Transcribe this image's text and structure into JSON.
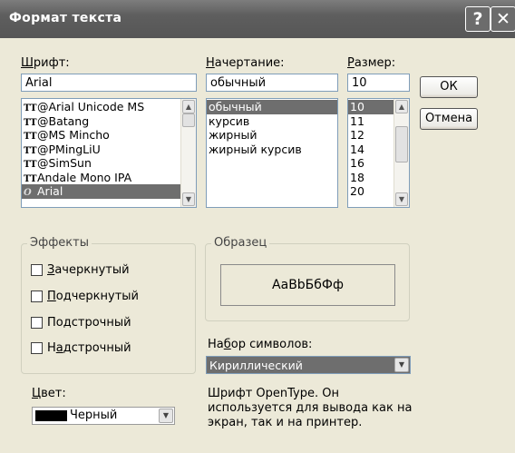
{
  "dialog": {
    "title": "Формат текста",
    "help_glyph": "?",
    "close_glyph": "✕"
  },
  "font": {
    "label_prefix": "",
    "label_u": "Ш",
    "label_rest": "рифт:",
    "value": "Arial",
    "items": [
      {
        "label": "@Arial Unicode MS",
        "icon": "TT"
      },
      {
        "label": "@Batang",
        "icon": "TT"
      },
      {
        "label": "@MS Mincho",
        "icon": "TT"
      },
      {
        "label": "@PMingLiU",
        "icon": "TT"
      },
      {
        "label": "@SimSun",
        "icon": "TT"
      },
      {
        "label": "Andale Mono IPA",
        "icon": "TT"
      },
      {
        "label": "Arial",
        "icon": "O",
        "selected": true
      }
    ]
  },
  "style": {
    "label_u": "Н",
    "label_rest": "ачертание:",
    "value": "обычный",
    "items": [
      {
        "label": "обычный",
        "selected": true
      },
      {
        "label": "курсив"
      },
      {
        "label": "жирный"
      },
      {
        "label": "жирный курсив"
      }
    ]
  },
  "size": {
    "label_u": "Р",
    "label_rest": "азмер:",
    "value": "10",
    "items": [
      {
        "label": "10",
        "selected": true
      },
      {
        "label": "11"
      },
      {
        "label": "12"
      },
      {
        "label": "14"
      },
      {
        "label": "16"
      },
      {
        "label": "18"
      },
      {
        "label": "20"
      }
    ]
  },
  "buttons": {
    "ok": "ОК",
    "cancel": "Отмена"
  },
  "effects": {
    "title": "Эффекты",
    "strikethrough": {
      "u": "З",
      "rest": "ачеркнутый"
    },
    "underline": {
      "u": "П",
      "rest": "одчеркнутый"
    },
    "subscript": {
      "pre": "По",
      "u": "д",
      "rest": "строчный"
    },
    "superscript": {
      "pre": "Н",
      "u": "а",
      "rest": "дстрочный"
    }
  },
  "sample": {
    "title": "Образец",
    "text": "AaBbБбФф"
  },
  "charset": {
    "label_pre": "На",
    "label_u": "б",
    "label_rest": "ор символов:",
    "value": "Кириллический"
  },
  "color": {
    "label_u": "Ц",
    "label_rest": "вет:",
    "value": "Черный",
    "swatch": "#000000"
  },
  "description": "Шрифт OpenType. Он используется для вывода как на экран, так и на принтер."
}
